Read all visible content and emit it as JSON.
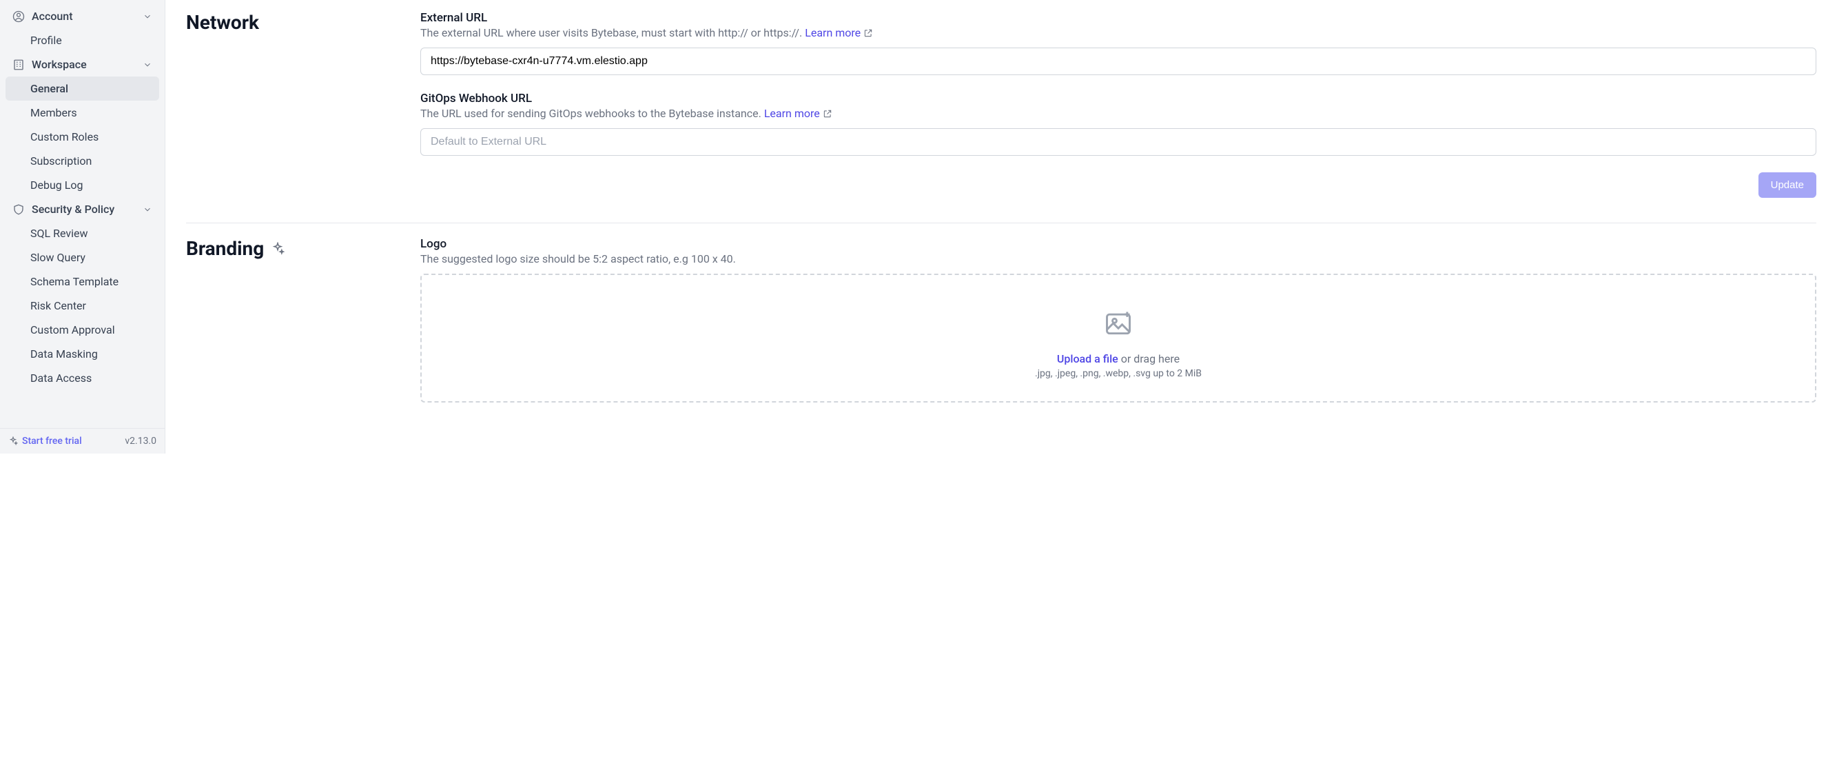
{
  "sidebar": {
    "groups": [
      {
        "label": "Account",
        "icon": "user",
        "items": [
          {
            "label": "Profile"
          }
        ]
      },
      {
        "label": "Workspace",
        "icon": "building",
        "items": [
          {
            "label": "General",
            "active": true
          },
          {
            "label": "Members"
          },
          {
            "label": "Custom Roles"
          },
          {
            "label": "Subscription"
          },
          {
            "label": "Debug Log"
          }
        ]
      },
      {
        "label": "Security & Policy",
        "icon": "shield",
        "items": [
          {
            "label": "SQL Review"
          },
          {
            "label": "Slow Query"
          },
          {
            "label": "Schema Template"
          },
          {
            "label": "Risk Center"
          },
          {
            "label": "Custom Approval"
          },
          {
            "label": "Data Masking"
          },
          {
            "label": "Data Access"
          }
        ]
      }
    ],
    "footer": {
      "trial": "Start free trial",
      "version": "v2.13.0"
    }
  },
  "network": {
    "title": "Network",
    "external_url_label": "External URL",
    "external_url_desc": "The external URL where user visits Bytebase, must start with http:// or https://.",
    "external_url_value": "https://bytebase-cxr4n-u7774.vm.elestio.app",
    "learn_more": "Learn more",
    "gitops_label": "GitOps Webhook URL",
    "gitops_desc": "The URL used for sending GitOps webhooks to the Bytebase instance.",
    "gitops_placeholder": "Default to External URL",
    "update_btn": "Update"
  },
  "branding": {
    "title": "Branding",
    "logo_label": "Logo",
    "logo_desc": "The suggested logo size should be 5:2 aspect ratio, e.g 100 x 40.",
    "upload_link": "Upload a file",
    "upload_rest": " or drag here",
    "upload_formats": ".jpg, .jpeg, .png, .webp, .svg up to 2 MiB"
  }
}
